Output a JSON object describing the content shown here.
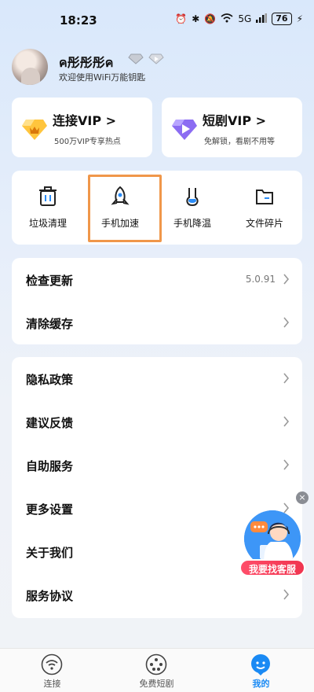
{
  "status_bar": {
    "time": "18:23",
    "network": "5G",
    "battery": "76"
  },
  "profile": {
    "username": "ค彤彤彤ค",
    "welcome": "欢迎使用WiFi万能钥匙"
  },
  "vip_cards": [
    {
      "title": "连接VIP >",
      "subtitle": "500万VIP专享热点",
      "icon": "gold-crown-diamond-icon"
    },
    {
      "title": "短剧VIP >",
      "subtitle": "免解锁，看剧不用等",
      "icon": "purple-play-diamond-icon"
    }
  ],
  "tools": [
    {
      "label": "垃圾清理",
      "icon": "trash-icon"
    },
    {
      "label": "手机加速",
      "icon": "rocket-icon"
    },
    {
      "label": "手机降温",
      "icon": "thermometer-icon"
    },
    {
      "label": "文件碎片",
      "icon": "folder-icon"
    }
  ],
  "settings_group1": [
    {
      "label": "检查更新",
      "value": "5.0.91"
    },
    {
      "label": "清除缓存",
      "value": ""
    }
  ],
  "settings_group2": [
    {
      "label": "隐私政策"
    },
    {
      "label": "建议反馈"
    },
    {
      "label": "自助服务"
    },
    {
      "label": "更多设置"
    },
    {
      "label": "关于我们"
    },
    {
      "label": "服务协议"
    }
  ],
  "floating_service": {
    "button": "我要找客服",
    "close": "×"
  },
  "tabbar": [
    {
      "label": "连接",
      "icon": "wifi-icon",
      "active": false
    },
    {
      "label": "免费短剧",
      "icon": "film-reel-icon",
      "active": false
    },
    {
      "label": "我的",
      "icon": "profile-icon",
      "active": true
    }
  ],
  "colors": {
    "accent": "#1a8af4",
    "highlight_border": "#f0974a",
    "service_button": "#f0344f"
  }
}
